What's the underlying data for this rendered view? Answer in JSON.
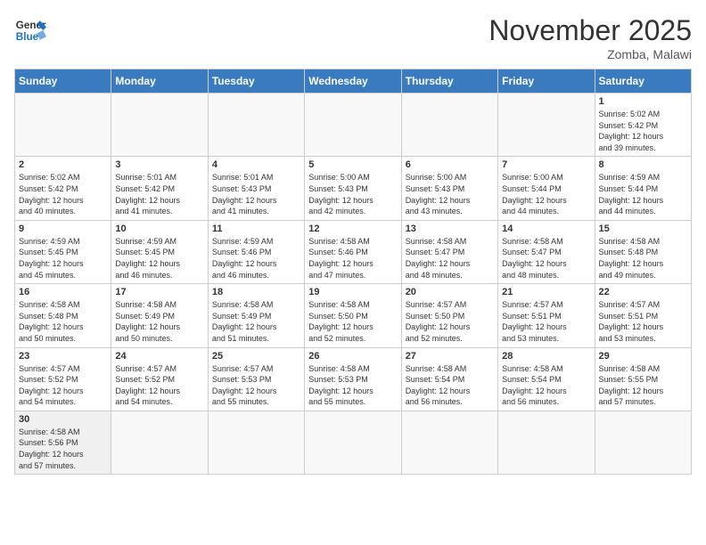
{
  "header": {
    "logo_general": "General",
    "logo_blue": "Blue",
    "month_year": "November 2025",
    "location": "Zomba, Malawi"
  },
  "days_of_week": [
    "Sunday",
    "Monday",
    "Tuesday",
    "Wednesday",
    "Thursday",
    "Friday",
    "Saturday"
  ],
  "weeks": [
    [
      {
        "day": "",
        "info": ""
      },
      {
        "day": "",
        "info": ""
      },
      {
        "day": "",
        "info": ""
      },
      {
        "day": "",
        "info": ""
      },
      {
        "day": "",
        "info": ""
      },
      {
        "day": "",
        "info": ""
      },
      {
        "day": "1",
        "info": "Sunrise: 5:02 AM\nSunset: 5:42 PM\nDaylight: 12 hours\nand 39 minutes."
      }
    ],
    [
      {
        "day": "2",
        "info": "Sunrise: 5:02 AM\nSunset: 5:42 PM\nDaylight: 12 hours\nand 40 minutes."
      },
      {
        "day": "3",
        "info": "Sunrise: 5:01 AM\nSunset: 5:42 PM\nDaylight: 12 hours\nand 41 minutes."
      },
      {
        "day": "4",
        "info": "Sunrise: 5:01 AM\nSunset: 5:43 PM\nDaylight: 12 hours\nand 41 minutes."
      },
      {
        "day": "5",
        "info": "Sunrise: 5:00 AM\nSunset: 5:43 PM\nDaylight: 12 hours\nand 42 minutes."
      },
      {
        "day": "6",
        "info": "Sunrise: 5:00 AM\nSunset: 5:43 PM\nDaylight: 12 hours\nand 43 minutes."
      },
      {
        "day": "7",
        "info": "Sunrise: 5:00 AM\nSunset: 5:44 PM\nDaylight: 12 hours\nand 44 minutes."
      },
      {
        "day": "8",
        "info": "Sunrise: 4:59 AM\nSunset: 5:44 PM\nDaylight: 12 hours\nand 44 minutes."
      }
    ],
    [
      {
        "day": "9",
        "info": "Sunrise: 4:59 AM\nSunset: 5:45 PM\nDaylight: 12 hours\nand 45 minutes."
      },
      {
        "day": "10",
        "info": "Sunrise: 4:59 AM\nSunset: 5:45 PM\nDaylight: 12 hours\nand 46 minutes."
      },
      {
        "day": "11",
        "info": "Sunrise: 4:59 AM\nSunset: 5:46 PM\nDaylight: 12 hours\nand 46 minutes."
      },
      {
        "day": "12",
        "info": "Sunrise: 4:58 AM\nSunset: 5:46 PM\nDaylight: 12 hours\nand 47 minutes."
      },
      {
        "day": "13",
        "info": "Sunrise: 4:58 AM\nSunset: 5:47 PM\nDaylight: 12 hours\nand 48 minutes."
      },
      {
        "day": "14",
        "info": "Sunrise: 4:58 AM\nSunset: 5:47 PM\nDaylight: 12 hours\nand 48 minutes."
      },
      {
        "day": "15",
        "info": "Sunrise: 4:58 AM\nSunset: 5:48 PM\nDaylight: 12 hours\nand 49 minutes."
      }
    ],
    [
      {
        "day": "16",
        "info": "Sunrise: 4:58 AM\nSunset: 5:48 PM\nDaylight: 12 hours\nand 50 minutes."
      },
      {
        "day": "17",
        "info": "Sunrise: 4:58 AM\nSunset: 5:49 PM\nDaylight: 12 hours\nand 50 minutes."
      },
      {
        "day": "18",
        "info": "Sunrise: 4:58 AM\nSunset: 5:49 PM\nDaylight: 12 hours\nand 51 minutes."
      },
      {
        "day": "19",
        "info": "Sunrise: 4:58 AM\nSunset: 5:50 PM\nDaylight: 12 hours\nand 52 minutes."
      },
      {
        "day": "20",
        "info": "Sunrise: 4:57 AM\nSunset: 5:50 PM\nDaylight: 12 hours\nand 52 minutes."
      },
      {
        "day": "21",
        "info": "Sunrise: 4:57 AM\nSunset: 5:51 PM\nDaylight: 12 hours\nand 53 minutes."
      },
      {
        "day": "22",
        "info": "Sunrise: 4:57 AM\nSunset: 5:51 PM\nDaylight: 12 hours\nand 53 minutes."
      }
    ],
    [
      {
        "day": "23",
        "info": "Sunrise: 4:57 AM\nSunset: 5:52 PM\nDaylight: 12 hours\nand 54 minutes."
      },
      {
        "day": "24",
        "info": "Sunrise: 4:57 AM\nSunset: 5:52 PM\nDaylight: 12 hours\nand 54 minutes."
      },
      {
        "day": "25",
        "info": "Sunrise: 4:57 AM\nSunset: 5:53 PM\nDaylight: 12 hours\nand 55 minutes."
      },
      {
        "day": "26",
        "info": "Sunrise: 4:58 AM\nSunset: 5:53 PM\nDaylight: 12 hours\nand 55 minutes."
      },
      {
        "day": "27",
        "info": "Sunrise: 4:58 AM\nSunset: 5:54 PM\nDaylight: 12 hours\nand 56 minutes."
      },
      {
        "day": "28",
        "info": "Sunrise: 4:58 AM\nSunset: 5:54 PM\nDaylight: 12 hours\nand 56 minutes."
      },
      {
        "day": "29",
        "info": "Sunrise: 4:58 AM\nSunset: 5:55 PM\nDaylight: 12 hours\nand 57 minutes."
      }
    ],
    [
      {
        "day": "30",
        "info": "Sunrise: 4:58 AM\nSunset: 5:56 PM\nDaylight: 12 hours\nand 57 minutes."
      },
      {
        "day": "",
        "info": ""
      },
      {
        "day": "",
        "info": ""
      },
      {
        "day": "",
        "info": ""
      },
      {
        "day": "",
        "info": ""
      },
      {
        "day": "",
        "info": ""
      },
      {
        "day": "",
        "info": ""
      }
    ]
  ]
}
